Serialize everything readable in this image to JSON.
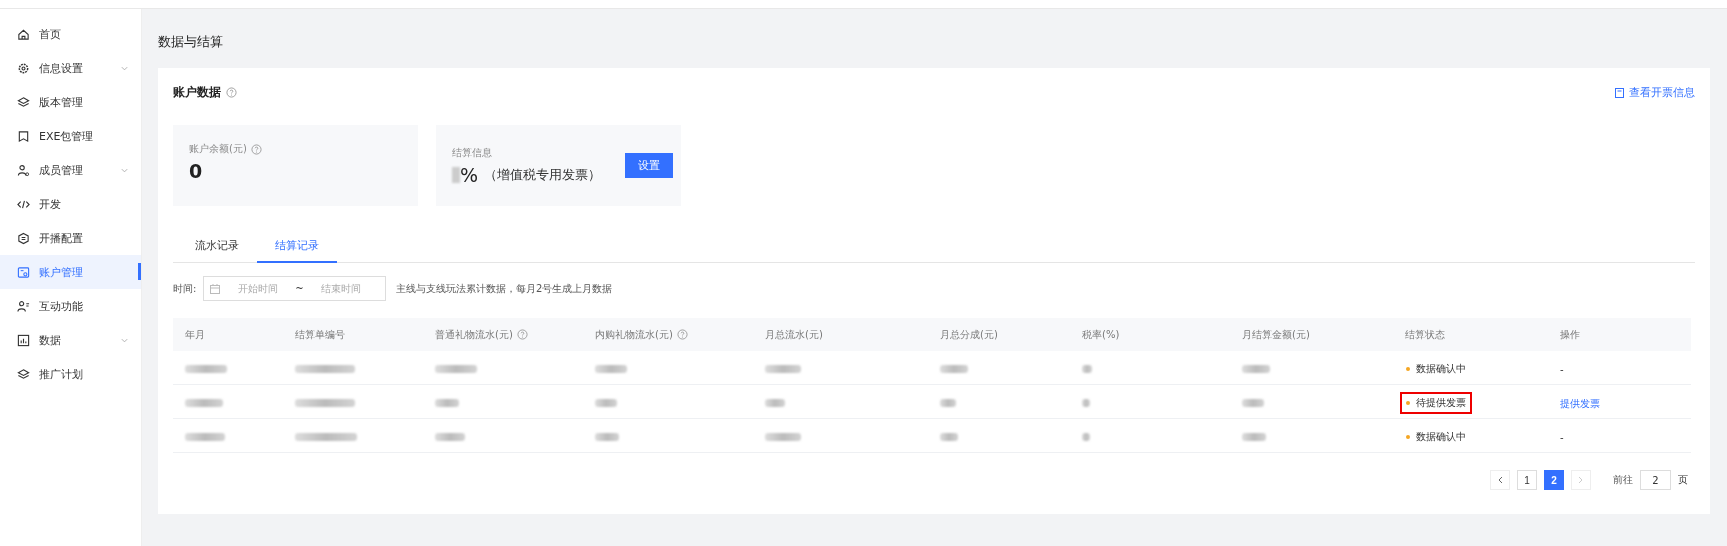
{
  "sidebar": {
    "items": [
      {
        "label": "首页",
        "expandable": false,
        "selected": false
      },
      {
        "label": "信息设置",
        "expandable": true,
        "selected": false
      },
      {
        "label": "版本管理",
        "expandable": false,
        "selected": false
      },
      {
        "label": "EXE包管理",
        "expandable": false,
        "selected": false
      },
      {
        "label": "成员管理",
        "expandable": true,
        "selected": false
      },
      {
        "label": "开发",
        "expandable": false,
        "selected": false
      },
      {
        "label": "开播配置",
        "expandable": false,
        "selected": false
      },
      {
        "label": "账户管理",
        "expandable": false,
        "selected": true
      },
      {
        "label": "互动功能",
        "expandable": false,
        "selected": false
      },
      {
        "label": "数据",
        "expandable": true,
        "selected": false
      },
      {
        "label": "推广计划",
        "expandable": false,
        "selected": false
      }
    ]
  },
  "page_title": "数据与结算",
  "account": {
    "title": "账户数据",
    "invoice_link": "查看开票信息",
    "balance": {
      "label": "账户余额(元)",
      "value": "0"
    },
    "settlement": {
      "label": "结算信息",
      "value": "%",
      "note": "（增值税专用发票）",
      "button": "设置"
    }
  },
  "tabs": [
    {
      "label": "流水记录",
      "selected": false
    },
    {
      "label": "结算记录",
      "selected": true
    }
  ],
  "filter": {
    "label": "时间:",
    "start_placeholder": "开始时间",
    "separator": "~",
    "end_placeholder": "结束时间",
    "hint": "主线与支线玩法累计数据，每月2号生成上月数据"
  },
  "table": {
    "columns": [
      {
        "label": "年月",
        "help": false
      },
      {
        "label": "结算单编号",
        "help": false
      },
      {
        "label": "普通礼物流水(元)",
        "help": true
      },
      {
        "label": "内购礼物流水(元)",
        "help": true
      },
      {
        "label": "月总流水(元)",
        "help": false
      },
      {
        "label": "月总分成(元)",
        "help": false
      },
      {
        "label": "税率(%)",
        "help": false
      },
      {
        "label": "月结算金额(元)",
        "help": false
      },
      {
        "label": "结算状态",
        "help": false
      },
      {
        "label": "操作",
        "help": false
      }
    ],
    "rows": [
      {
        "status": "数据确认中",
        "color": "#f5a623",
        "action": "-",
        "kind": "text",
        "highlighted": false
      },
      {
        "status": "待提供发票",
        "color": "#f5a623",
        "action": "提供发票",
        "kind": "link",
        "highlighted": true
      },
      {
        "status": "数据确认中",
        "color": "#f5a623",
        "action": "-",
        "kind": "text",
        "highlighted": false
      }
    ]
  },
  "pagination": {
    "pages": [
      {
        "label": "1",
        "selected": false
      },
      {
        "label": "2",
        "selected": true
      }
    ],
    "goto_label": "前往",
    "goto_value": "2",
    "page_unit": "页"
  }
}
